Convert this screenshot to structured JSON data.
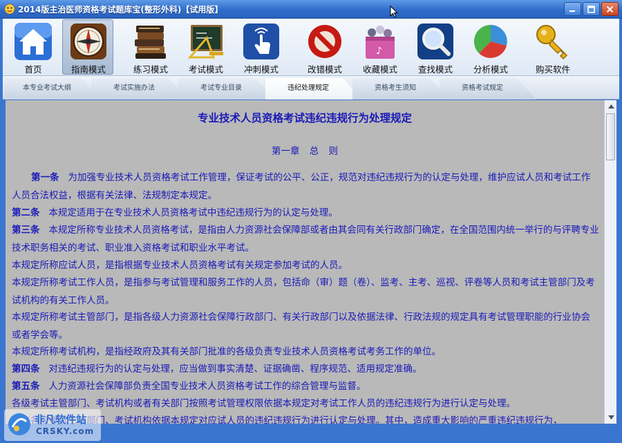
{
  "window": {
    "title": "2014版主治医师资格考试题库宝(整形外科)【试用版】"
  },
  "toolbar": {
    "items": [
      {
        "label": "首页",
        "icon": "home-icon"
      },
      {
        "label": "指南模式",
        "icon": "compass-icon",
        "active": true
      },
      {
        "label": "练习模式",
        "icon": "books-icon"
      },
      {
        "label": "考试模式",
        "icon": "blackboard-icon"
      },
      {
        "label": "冲刺模式",
        "icon": "touch-hand-icon"
      },
      {
        "label": "改错模式",
        "icon": "no-sign-icon"
      },
      {
        "label": "收藏模式",
        "icon": "treasure-box-icon"
      },
      {
        "label": "查找模式",
        "icon": "magnifier-icon"
      },
      {
        "label": "分析模式",
        "icon": "pie-chart-icon"
      },
      {
        "label": "购买软件",
        "icon": "key-icon"
      }
    ]
  },
  "tabs": [
    {
      "label": "本专业考试大纲"
    },
    {
      "label": "考试实施办法"
    },
    {
      "label": "考试专业目录"
    },
    {
      "label": "违纪处理规定",
      "active": true
    },
    {
      "label": "资格考生须知"
    },
    {
      "label": "资格考试规定"
    }
  ],
  "document": {
    "title": "专业技术人员资格考试违纪违规行为处理规定",
    "chapter": "第一章 总 则",
    "paragraphs": [
      {
        "lead": "第一条",
        "text": "为加强专业技术人员资格考试工作管理，保证考试的公平、公正，规范对违纪违规行为的认定与处理，维护应试人员和考试工作人员合法权益，根据有关法律、法规制定本规定。"
      },
      {
        "lead": "第二条",
        "text": "本规定适用于在专业技术人员资格考试中违纪违规行为的认定与处理。"
      },
      {
        "lead": "第三条",
        "text": "本规定所称专业技术人员资格考试，是指由人力资源社会保障部或者由其会同有关行政部门确定，在全国范围内统一举行的与评聘专业技术职务相关的考试、职业准入资格考试和职业水平考试。"
      },
      {
        "lead": "",
        "text": "本规定所称应试人员，是指根据专业技术人员资格考试有关规定参加考试的人员。"
      },
      {
        "lead": "",
        "text": "本规定所称考试工作人员，是指参与考试管理和服务工作的人员，包括命（审）题（卷）、监考、主考、巡视、评卷等人员和考试主管部门及考试机构的有关工作人员。"
      },
      {
        "lead": "",
        "text": "本规定所称考试主管部门，是指各级人力资源社会保障行政部门、有关行政部门以及依据法律、行政法规的规定具有考试管理职能的行业协会或者学会等。"
      },
      {
        "lead": "",
        "text": "本规定所称考试机构，是指经政府及其有关部门批准的各级负责专业技术人员资格考试考务工作的单位。"
      },
      {
        "lead": "第四条",
        "text": "对违纪违规行为的认定与处理，应当做到事实清楚、证据确凿、程序规范、适用规定准确。"
      },
      {
        "lead": "第五条",
        "text": "人力资源社会保障部负责全国专业技术人员资格考试工作的综合管理与监督。"
      },
      {
        "lead": "",
        "text": "各级考试主管部门、考试机构或者有关部门按照考试管理权限依据本规定对考试工作人员的违纪违规行为进行认定与处理。"
      },
      {
        "lead": "",
        "text": "地方各级考试主管部门、考试机构依据本规定对应试人员的违纪违规行为进行认定与处理。其中，造成重大影响的严重违纪违规行为，"
      }
    ]
  },
  "watermark": {
    "text": "非凡软件站",
    "sub": "CRSKY.com"
  },
  "colors": {
    "frame": "#3a76cf",
    "content_bg": "#b9b9b9",
    "text": "#1a1ab8"
  }
}
